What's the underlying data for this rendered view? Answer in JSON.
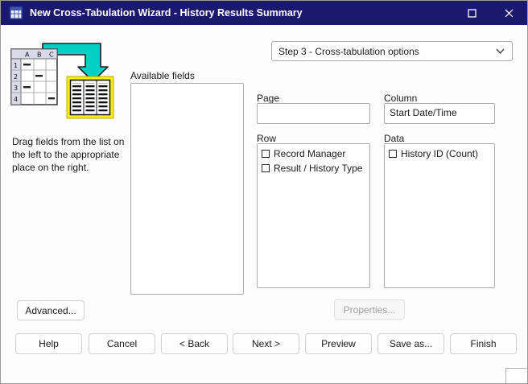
{
  "window": {
    "title": "New Cross-Tabulation Wizard - History Results Summary"
  },
  "step_dropdown": {
    "value": "Step 3 - Cross-tabulation options"
  },
  "instructions": "Drag fields from the list on the left to the appropriate place on the right.",
  "available_fields": {
    "label": "Available fields",
    "items": []
  },
  "sections": {
    "page": {
      "label": "Page",
      "value": ""
    },
    "column": {
      "label": "Column",
      "value": "Start Date/Time"
    },
    "row": {
      "label": "Row",
      "items": [
        "Record Manager",
        "Result / History Type"
      ]
    },
    "data": {
      "label": "Data",
      "items": [
        "History ID (Count)"
      ]
    }
  },
  "buttons": {
    "advanced": "Advanced...",
    "properties": "Properties...",
    "help": "Help",
    "cancel": "Cancel",
    "back": "< Back",
    "next": "Next >",
    "preview": "Preview",
    "save_as": "Save as...",
    "finish": "Finish"
  },
  "icons": {
    "app": "table-wizard-icon",
    "maximize": "maximize-icon",
    "close": "close-icon",
    "chevron": "chevron-down-icon",
    "field": "field-box-icon"
  },
  "colors": {
    "titlebar": "#191970",
    "arrow": "#00cfc4",
    "highlight": "#f7ec13"
  }
}
